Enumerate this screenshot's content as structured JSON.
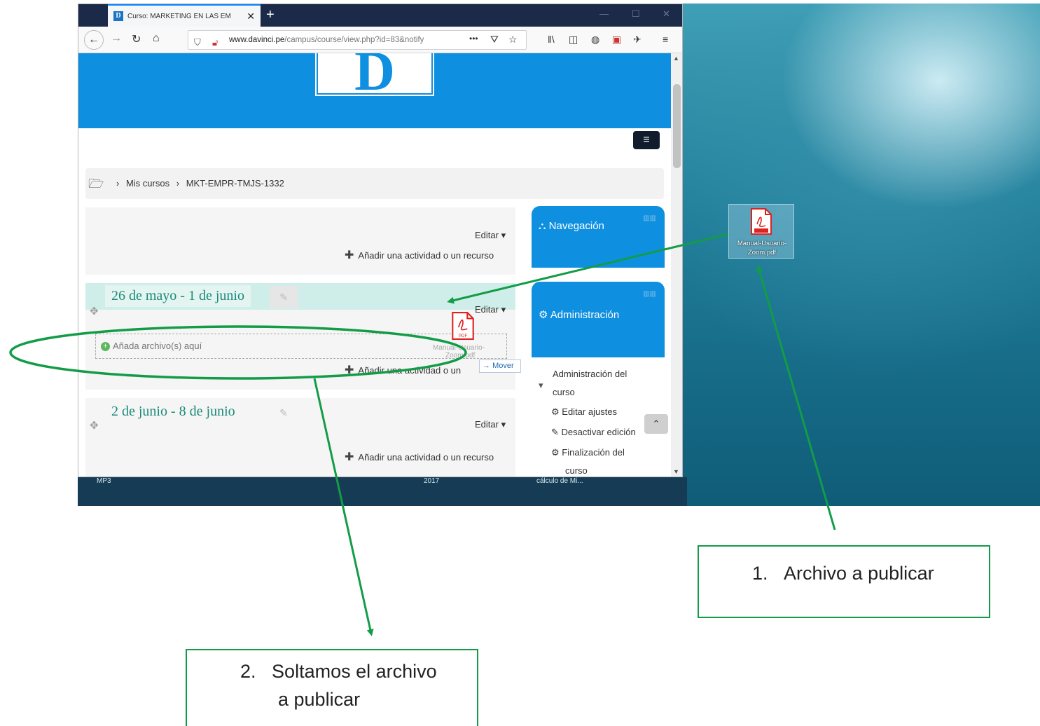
{
  "browser": {
    "tab_icon": "D",
    "tab_title": "Curso: MARKETING EN LAS EM",
    "url_host": "www.davinci.pe",
    "url_path": "/campus/course/view.php?id=83&notify",
    "url_more": "•••"
  },
  "site": {
    "logo_letter": "D"
  },
  "breadcrumb": {
    "sep1": "›",
    "item1": "Mis cursos",
    "sep2": "›",
    "item2": "MKT-EMPR-TMJS-1332"
  },
  "course": {
    "edit_label": "Editar",
    "add_activity": "Añadir una actividad o un recurso",
    "add_activity_partial_a": "Añadir una actividad o un",
    "dropzone_text": "Añada archivo(s) aquí",
    "move_label": "Mover",
    "drag_caption": "Manual-Usuario-",
    "drag_caption2": "Zoom.pdf",
    "sections": [
      {
        "title": "26 de mayo - 1 de junio"
      },
      {
        "title": "2 de junio - 8 de junio"
      }
    ]
  },
  "blocks": {
    "navigation": "Navegación",
    "administration": "Administración",
    "admin_items": [
      "Administración del",
      "curso",
      "Editar ajustes",
      "Desactivar edición",
      "Finalización del",
      "curso"
    ]
  },
  "desktop": {
    "file_caption_line1": "Manual-Usuario-",
    "file_caption_line2": "Zoom.pdf",
    "taskbar_labels": [
      "MP3",
      "2017",
      "cálculo de Mi..."
    ]
  },
  "annotations": {
    "step1_number": "1.",
    "step1_text": "Archivo a publicar",
    "step2_number": "2.",
    "step2_line1": "Soltamos el archivo",
    "step2_line2": "a publicar"
  },
  "colors": {
    "annotation_green": "#139c48",
    "moodle_blue": "#0f8fe0",
    "section_teal": "#1a8a7a"
  }
}
